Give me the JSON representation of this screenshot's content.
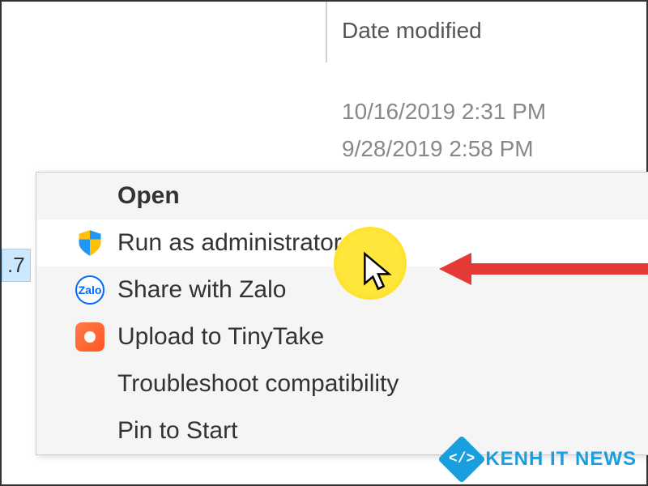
{
  "explorer": {
    "column_header": "Date modified",
    "dates": [
      "10/16/2019 2:31 PM",
      "9/28/2019 2:58 PM"
    ],
    "selected_file_fragment": ".7"
  },
  "context_menu": {
    "items": [
      {
        "label": "Open",
        "bold": true,
        "icon": null
      },
      {
        "label": "Run as administrator",
        "bold": false,
        "icon": "shield",
        "highlighted": true
      },
      {
        "label": "Share with Zalo",
        "bold": false,
        "icon": "zalo"
      },
      {
        "label": "Upload to TinyTake",
        "bold": false,
        "icon": "tinytake"
      },
      {
        "label": "Troubleshoot compatibility",
        "bold": false,
        "icon": null
      },
      {
        "label": "Pin to Start",
        "bold": false,
        "icon": null
      }
    ]
  },
  "watermark": {
    "text": "KENH IT NEWS",
    "icon_glyph": "</>"
  }
}
